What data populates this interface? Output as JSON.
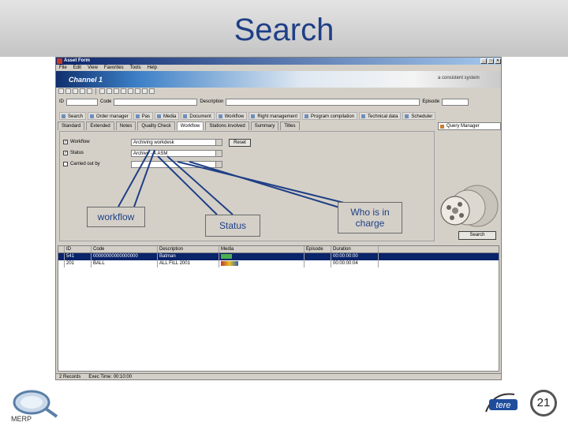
{
  "slide": {
    "title": "Search",
    "page_number": "21",
    "footer_logo_label": "MERP",
    "partner_logo_text": "tere"
  },
  "callouts": {
    "workflow": "workflow",
    "status": "Status",
    "who_in_charge": "Who is in charge"
  },
  "app": {
    "window_title": "Asset Form",
    "menu": [
      "File",
      "Edit",
      "View",
      "Favorites",
      "Tools",
      "Help"
    ],
    "channel_label": "Channel 1",
    "tagline": "a consistent system",
    "fields": {
      "id_label": "ID",
      "code_label": "Code",
      "description_label": "Description",
      "episode_label": "Episode"
    },
    "module_tabs": [
      "Search",
      "Order manager",
      "Pas",
      "Media",
      "Document",
      "Workflow",
      "Right management",
      "Program compilation",
      "Technical data",
      "Scheduler"
    ],
    "sub_tabs": [
      "Standard",
      "Extended",
      "Notes",
      "Quality Check",
      "Workflow",
      "Stations involved",
      "Summary",
      "Titles"
    ],
    "active_sub_tab": "Workflow",
    "query_manager": "Query Manager",
    "criteria": [
      {
        "checked": true,
        "label": "Workflow",
        "value": "Archiving workdesk"
      },
      {
        "checked": true,
        "label": "Status",
        "value": "Archive - 4.ASM"
      },
      {
        "checked": false,
        "label": "Carried out by",
        "value": ""
      }
    ],
    "reset_label": "Reset",
    "search_label": "Search",
    "grid": {
      "headers": [
        "",
        "ID",
        "Code",
        "Description",
        "Media",
        "Episode",
        "Duration"
      ],
      "rows": [
        [
          "",
          "541",
          "00000000000000000",
          "Batman",
          "",
          "",
          "00:00:00:00"
        ],
        [
          "",
          "201",
          "BALL",
          "ALL FILL 2001",
          "",
          "",
          "00:00:00:04"
        ]
      ]
    },
    "status_records": "2 Records",
    "status_exec_time": "Exec Time: 00:10:00"
  },
  "colors": {
    "title": "#1f3f86",
    "header_band": "#c8c8c8",
    "grid_selection": "#0a246a",
    "arrow": "#1f3f86"
  }
}
